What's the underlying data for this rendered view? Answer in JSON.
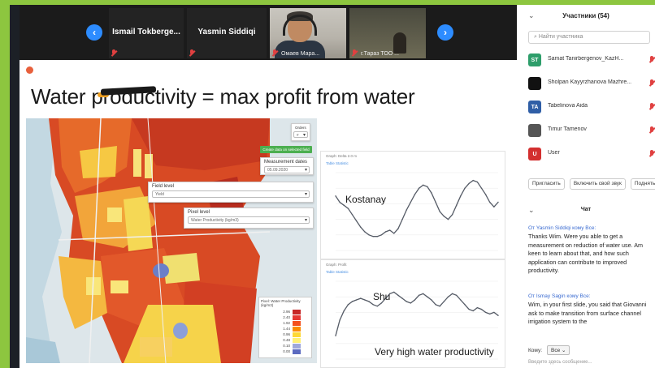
{
  "video_strip": {
    "participants": [
      {
        "name": "Ismail  Tokberge...",
        "label": ""
      },
      {
        "name": "Yasmin Siddiqi",
        "label": ""
      },
      {
        "name": "",
        "label": "Омаев Мара..."
      },
      {
        "name": "",
        "label": "г.Тараз ТОО ..."
      }
    ]
  },
  "slide": {
    "title": "Water productivity = max profit from water",
    "map": {
      "order_label": "Orders",
      "order_value": "#",
      "green_button": "Create data on selected field",
      "measurement_label": "Measurement dates",
      "measurement_value": "05.09.2020",
      "field_level_label": "Field level",
      "field_level_value": "Yield",
      "pixel_level_label": "Pixel level",
      "pixel_level_value": "Water Productivity (kg/m3)",
      "legend_title": "Pixel: Water Productivity (kg/m3)",
      "legend": [
        {
          "value": "2.96",
          "color": "#c62828"
        },
        {
          "value": "2.40",
          "color": "#e53935"
        },
        {
          "value": "1.92",
          "color": "#f4511e"
        },
        {
          "value": "1.44",
          "color": "#fb8c00"
        },
        {
          "value": "0.96",
          "color": "#fdd835"
        },
        {
          "value": "0.48",
          "color": "#fff176"
        },
        {
          "value": "0.10",
          "color": "#9fa8da"
        },
        {
          "value": "0.00",
          "color": "#5c6bc0"
        }
      ]
    },
    "charts": [
      {
        "head": "Graph: Delta 2.0 m",
        "tabs": "Table     Statistic",
        "annotation": "Kostanay"
      },
      {
        "head": "Graph: Profit",
        "tabs": "Table     Statistic",
        "annotation": "Shu",
        "annotation2": "Very high water productivity"
      }
    ],
    "chart_data": [
      {
        "type": "line",
        "title": "",
        "annotation": "Kostanay",
        "x": [
          0,
          1,
          2,
          3,
          4,
          5,
          6,
          7,
          8,
          9,
          10,
          11,
          12,
          13,
          14,
          15,
          16,
          17,
          18,
          19,
          20,
          21,
          22,
          23,
          24,
          25,
          26,
          27,
          28,
          29,
          30,
          31,
          32,
          33,
          34,
          35,
          36,
          37,
          38,
          39
        ],
        "series": [
          {
            "values": [
              0.7,
              0.62,
              0.58,
              0.54,
              0.46,
              0.38,
              0.3,
              0.24,
              0.2,
              0.18,
              0.18,
              0.2,
              0.24,
              0.26,
              0.22,
              0.28,
              0.4,
              0.52,
              0.62,
              0.72,
              0.8,
              0.84,
              0.82,
              0.74,
              0.62,
              0.5,
              0.44,
              0.4,
              0.46,
              0.58,
              0.7,
              0.8,
              0.86,
              0.9,
              0.88,
              0.8,
              0.72,
              0.62,
              0.56,
              0.62
            ]
          }
        ]
      },
      {
        "type": "line",
        "title": "",
        "annotation": "Shu",
        "x": [
          0,
          1,
          2,
          3,
          4,
          5,
          6,
          7,
          8,
          9,
          10,
          11,
          12,
          13,
          14,
          15,
          16,
          17,
          18,
          19,
          20,
          21,
          22,
          23,
          24,
          25,
          26,
          27,
          28,
          29,
          30,
          31,
          32,
          33,
          34,
          35,
          36,
          37,
          38,
          39
        ],
        "series": [
          {
            "values": [
              0.3,
              0.5,
              0.62,
              0.7,
              0.74,
              0.76,
              0.78,
              0.76,
              0.74,
              0.7,
              0.68,
              0.72,
              0.78,
              0.84,
              0.86,
              0.82,
              0.78,
              0.74,
              0.72,
              0.76,
              0.82,
              0.84,
              0.8,
              0.76,
              0.7,
              0.68,
              0.74,
              0.8,
              0.84,
              0.82,
              0.76,
              0.7,
              0.64,
              0.62,
              0.66,
              0.64,
              0.6,
              0.58,
              0.6,
              0.56
            ]
          }
        ]
      }
    ]
  },
  "sidebar": {
    "title": "Участники (54)",
    "search_placeholder": "Найти участника",
    "participants": [
      {
        "initials": "ST",
        "color": "#2e9e6b",
        "name": "Samat Tanirbergenov_KazH..."
      },
      {
        "initials": "",
        "color": "#111111",
        "name": "Sholpan Kayyrzhanova Mazhre..."
      },
      {
        "initials": "TA",
        "color": "#2f5ea6",
        "name": "Tabelinova Aida"
      },
      {
        "initials": "",
        "color": "#555555",
        "name": "Timur Tamenov"
      },
      {
        "initials": "U",
        "color": "#d32f2f",
        "name": "User"
      }
    ],
    "actions": [
      "Пригласить",
      "Включить свой звук",
      "Подняться"
    ],
    "chat_title": "Чат",
    "messages": [
      {
        "from": "От Yasmin Siddiqi кому Все:",
        "text": "Thanks Wim. Were you able to get a measurement on reduction of water use. Am keen to learn about that, and how such application can contribute to improved productivity."
      },
      {
        "from": "От Ismay Sagin кому Все:",
        "text": "Wim, in your first slide, you said that Giovanni ask to make transition from surface channel irrigation system to the"
      }
    ],
    "to_label": "Кому:",
    "to_value": "Все",
    "input_placeholder": "Введите здесь сообщение..."
  }
}
